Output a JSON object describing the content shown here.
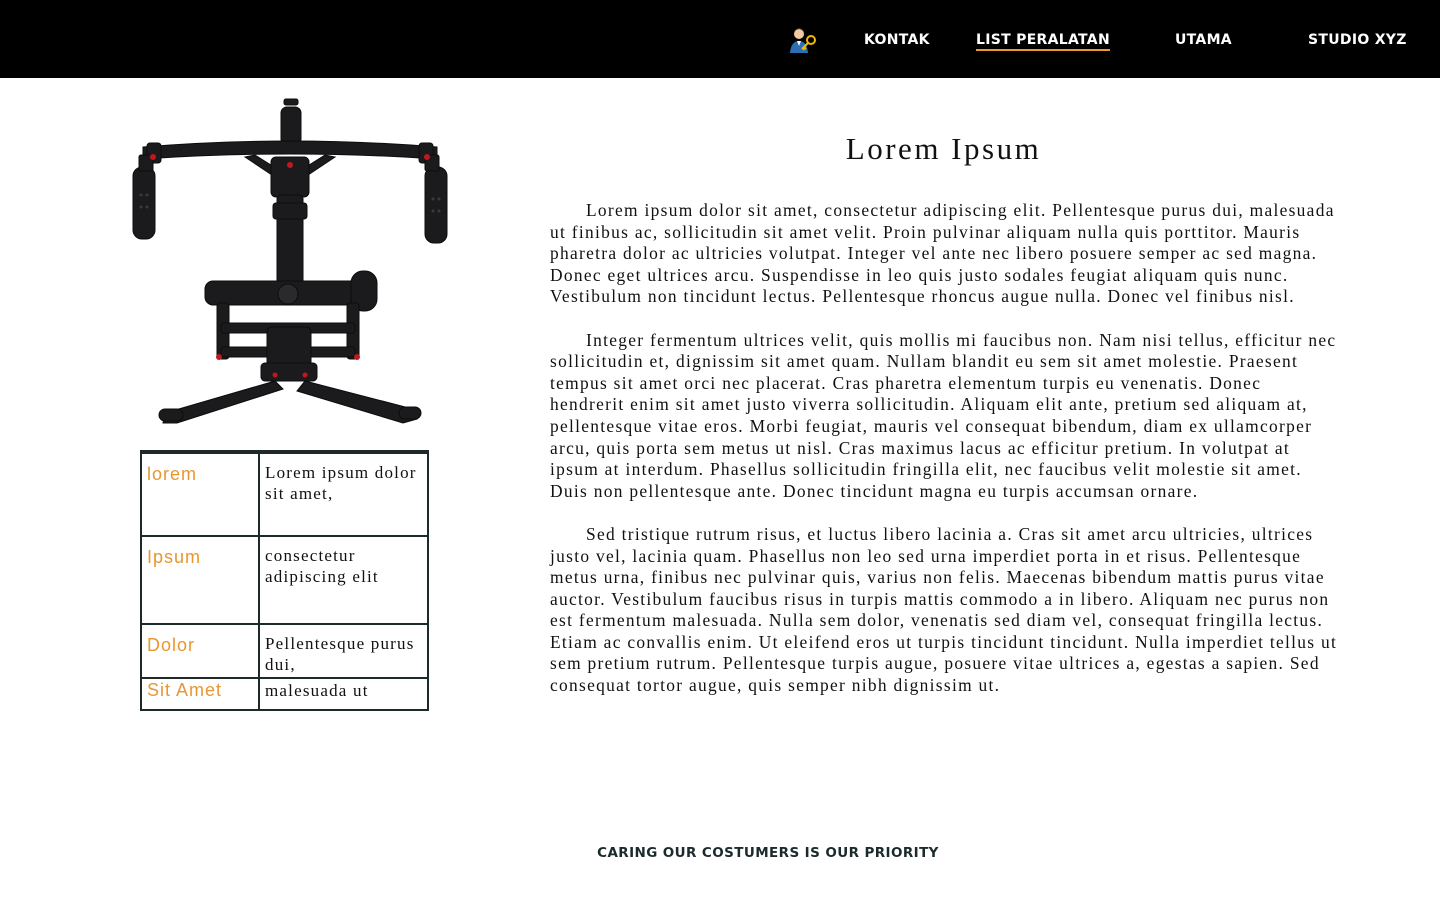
{
  "header": {
    "nav": [
      {
        "label": "KONTAK",
        "active": false
      },
      {
        "label": "LIST PERALATAN",
        "active": true
      },
      {
        "label": "UTAMA",
        "active": false
      },
      {
        "label": "STUDIO XYZ",
        "active": false
      }
    ],
    "user_icon": "user-key-icon",
    "accent_color": "#e89a2c",
    "background": "#000000"
  },
  "product": {
    "image_icon": "camera-gimbal-stabilizer",
    "specs": [
      {
        "key": "lorem",
        "value": "Lorem ipsum dolor sit amet,"
      },
      {
        "key": "Ipsum",
        "value": "consectetur adipiscing elit"
      },
      {
        "key": "Dolor",
        "value": "Pellentesque purus dui,"
      },
      {
        "key": "Sit Amet",
        "value": "malesuada ut"
      }
    ],
    "key_color": "#e8962e"
  },
  "article": {
    "title": "Lorem Ipsum",
    "paragraphs": [
      "Lorem ipsum dolor sit amet, consectetur adipiscing elit. Pellentesque purus dui, malesuada ut finibus ac, sollicitudin sit amet velit. Proin pulvinar aliquam nulla quis porttitor. Mauris pharetra dolor ac ultricies volutpat. Integer vel ante nec libero posuere semper ac sed magna. Donec eget ultrices arcu. Suspendisse in leo quis justo sodales feugiat aliquam quis nunc. Vestibulum non tincidunt lectus. Pellentesque rhoncus augue nulla. Donec vel finibus nisl.",
      "Integer fermentum ultrices velit, quis mollis mi faucibus non. Nam nisi tellus, efficitur nec sollicitudin et, dignissim sit amet quam. Nullam blandit eu sem sit amet molestie. Praesent tempus sit amet orci nec placerat. Cras pharetra elementum turpis eu venenatis. Donec hendrerit enim sit amet justo viverra sollicitudin. Aliquam elit ante, pretium sed aliquam at, pellentesque vitae eros. Morbi feugiat, mauris vel consequat bibendum, diam ex ullamcorper arcu, quis porta sem metus ut nisl. Cras maximus lacus ac efficitur pretium. In volutpat at ipsum at interdum. Phasellus sollicitudin fringilla elit, nec faucibus velit molestie sit amet. Duis non pellentesque ante. Donec tincidunt magna eu turpis accumsan ornare.",
      "Sed tristique rutrum risus, et luctus libero lacinia a. Cras sit amet arcu ultricies, ultrices justo vel, lacinia quam. Phasellus non leo sed urna imperdiet porta in et risus. Pellentesque metus urna, finibus nec pulvinar quis, varius non felis. Maecenas bibendum mattis purus vitae auctor. Vestibulum faucibus risus in turpis mattis commodo a in libero. Aliquam nec purus non est fermentum malesuada. Nulla sem dolor, venenatis sed diam vel, consequat fringilla lectus. Etiam ac convallis enim. Ut eleifend eros ut turpis tincidunt tincidunt. Nulla imperdiet tellus ut sem pretium rutrum. Pellentesque turpis augue, posuere vitae ultrices a, egestas a sapien. Sed consequat tortor augue, quis semper nibh dignissim ut."
    ]
  },
  "footer": {
    "tagline": "CARING OUR COSTUMERS IS OUR PRIORITY"
  }
}
